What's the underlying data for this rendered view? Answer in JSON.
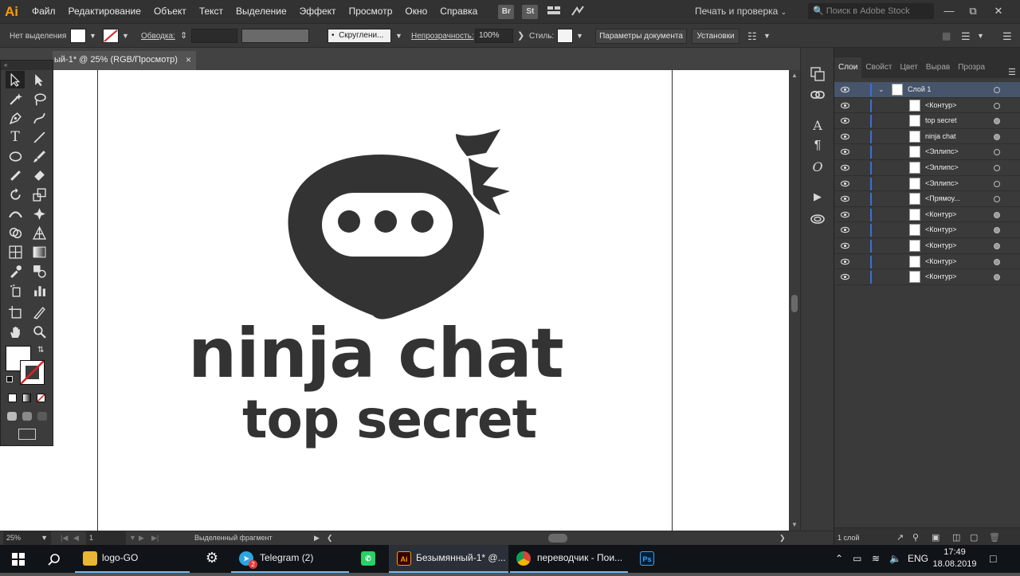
{
  "app": {
    "logo": "Ai",
    "menu": [
      "Файл",
      "Редактирование",
      "Объект",
      "Текст",
      "Выделение",
      "Эффект",
      "Просмотр",
      "Окно",
      "Справка"
    ],
    "bridge_icon": "Br",
    "stock_icon": "St",
    "workspace_label": "Печать и проверка",
    "stock_search_placeholder": "Поиск в Adobe Stock"
  },
  "control_bar": {
    "selection_label": "Нет выделения",
    "stroke_label": "Обводка:",
    "brush_label": "Скруглени...",
    "opacity_label": "Непрозрачность:",
    "opacity_value": "100%",
    "style_label": "Стиль:",
    "doc_setup_button": "Параметры документа",
    "preferences_button": "Установки"
  },
  "document": {
    "tab_title": "ый-1* @ 25% (RGB/Просмотр)",
    "tab_close": "×"
  },
  "artwork": {
    "headline": "ninja chat",
    "subline": "top secret",
    "ink_color": "#333333"
  },
  "layers_panel": {
    "tabs": [
      "Слои",
      "Свойст",
      "Цвет",
      "Вырав",
      "Прозра"
    ],
    "active_tab": "Слои",
    "rows": [
      {
        "name": "Слой 1",
        "target_filled": false
      },
      {
        "name": "<Контур>",
        "target_filled": false
      },
      {
        "name": "top secret",
        "target_filled": true
      },
      {
        "name": "ninja chat",
        "target_filled": true
      },
      {
        "name": "<Эллипс>",
        "target_filled": false
      },
      {
        "name": "<Эллипс>",
        "target_filled": false
      },
      {
        "name": "<Эллипс>",
        "target_filled": false
      },
      {
        "name": "<Прямоу...",
        "target_filled": false
      },
      {
        "name": "<Контур>",
        "target_filled": true
      },
      {
        "name": "<Контур>",
        "target_filled": true
      },
      {
        "name": "<Контур>",
        "target_filled": true
      },
      {
        "name": "<Контур>",
        "target_filled": true
      },
      {
        "name": "<Контур>",
        "target_filled": true
      }
    ],
    "footer_count": "1 слой"
  },
  "status_bar": {
    "zoom": "25%",
    "artboard_number": "1",
    "selection_info": "Выделенный фрагмент"
  },
  "taskbar": {
    "items": [
      {
        "label": "logo-GO",
        "icon": "folder-icon"
      },
      {
        "label": "Telegram (2)",
        "icon": "telegram-icon"
      },
      {
        "label": "Безымянный-1* @...",
        "icon": "illustrator-icon"
      },
      {
        "label": "переводчик - Пои...",
        "icon": "chrome-icon"
      }
    ],
    "telegram_badge": "2",
    "language": "ENG",
    "time": "17:49",
    "date": "18.08.2019"
  }
}
